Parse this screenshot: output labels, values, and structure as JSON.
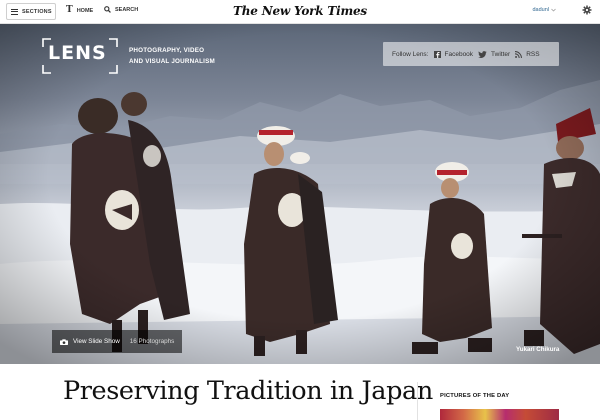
{
  "nav": {
    "sections_label": "SECTIONS",
    "home_label": "HOME",
    "search_label": "SEARCH",
    "logo_text": "The New York Times",
    "user_name": "dadunl",
    "t_glyph": "T"
  },
  "lens": {
    "wordmark": "LENS",
    "tagline_line1": "PHOTOGRAPHY, VIDEO",
    "tagline_line2": "AND VISUAL JOURNALISM",
    "follow_label": "Follow Lens:",
    "follow_facebook": "Facebook",
    "follow_twitter": "Twitter",
    "follow_rss": "RSS"
  },
  "hero": {
    "slideshow_label": "View Slide Show",
    "photo_count": "16 Photographs",
    "photo_credit": "Yukari Chikura"
  },
  "article": {
    "headline": "Preserving Tradition in Japan"
  },
  "sidebar": {
    "pictures_of_the_day": "PICTURES OF THE DAY"
  },
  "icons": {
    "menu": "hamburger-icon",
    "home": "nyt-t-icon",
    "search": "magnifier-icon",
    "settings": "gear-icon",
    "facebook": "facebook-icon",
    "twitter": "twitter-bird-icon",
    "rss": "rss-icon",
    "slideshow": "camera-icon",
    "dropdown": "chevron-down-icon"
  },
  "colors": {
    "link_blue": "#326891",
    "hat_red": "#b4232d",
    "hero_sky": "#7c8596"
  }
}
